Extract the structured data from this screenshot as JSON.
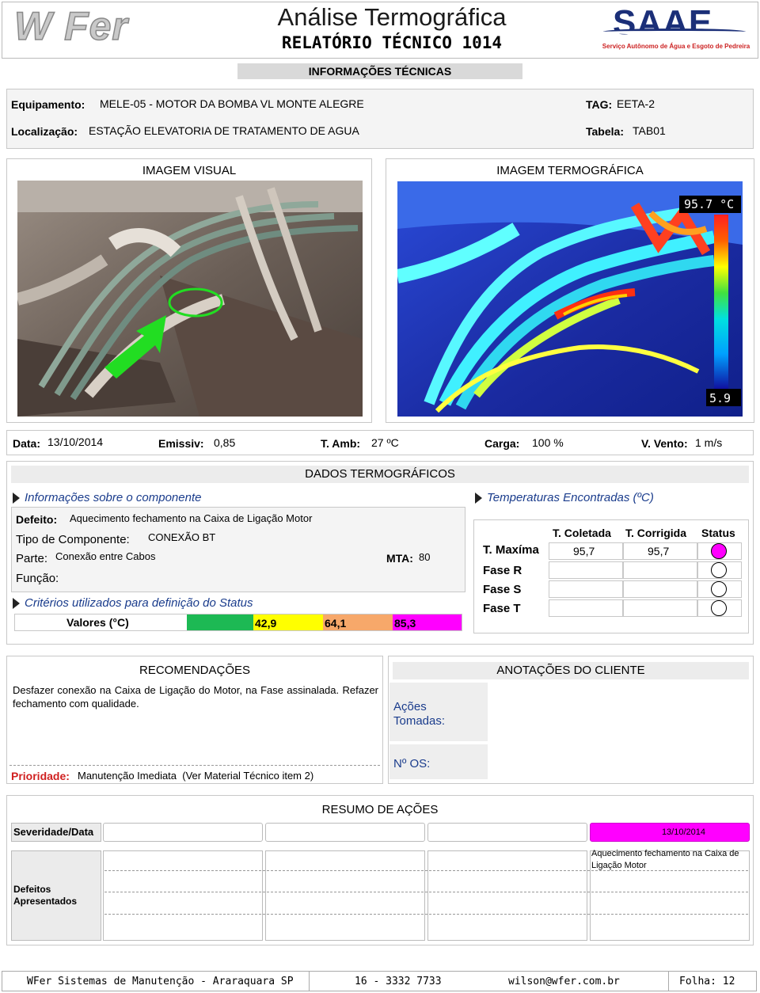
{
  "header": {
    "logo_text": "W Fer",
    "title": "Análise Termográfica",
    "subtitle": "RELATÓRIO TÉCNICO 1014",
    "saae_logo": "SAAE",
    "saae_caption": "Serviço Autônomo de Água e Esgoto de Pedreira"
  },
  "info": {
    "section_title": "INFORMAÇÕES TÉCNICAS",
    "equipamento_label": "Equipamento:",
    "equipamento_value": "MELE-05 - MOTOR DA BOMBA VL MONTE ALEGRE",
    "localizacao_label": "Localização:",
    "localizacao_value": "ESTAÇÃO ELEVATORIA DE TRATAMENTO DE AGUA",
    "tag_label": "TAG:",
    "tag_value": "EETA-2",
    "tabela_label": "Tabela:",
    "tabela_value": "TAB01"
  },
  "images": {
    "visual_title": "IMAGEM VISUAL",
    "thermo_title": "IMAGEM TERMOGRÁFICA",
    "scale_max": "95.7 °C",
    "scale_min": "5.9"
  },
  "conditions": {
    "data_label": "Data:",
    "data_value": "13/10/2014",
    "emissiv_label": "Emissiv:",
    "emissiv_value": "0,85",
    "tamb_label": "T. Amb:",
    "tamb_value": "27 ºC",
    "carga_label": "Carga:",
    "carga_value": "100 %",
    "vento_label": "V. Vento:",
    "vento_value": "1 m/s"
  },
  "dados": {
    "title": "DADOS TERMOGRÁFICOS",
    "component_info_title": "Informações sobre o componente",
    "temps_title": "Temperaturas Encontradas (ºC)",
    "defeito_label": "Defeito:",
    "defeito_value": "Aquecimento fechamento na Caixa de Ligação Motor",
    "tipo_label": "Tipo de Componente:",
    "tipo_value": "CONEXÃO BT",
    "parte_label": "Parte:",
    "parte_value": "Conexão entre Cabos",
    "mta_label": "MTA:",
    "mta_value": "80",
    "funcao_label": "Função:",
    "criterios_title": "Critérios utilizados para definição do Status",
    "valores_label": "Valores (°C)",
    "thresholds": [
      "42,9",
      "64,1",
      "85,3"
    ],
    "threshold_colors": [
      "#1db954",
      "#ffff00",
      "#f7a86a",
      "#ff00ff"
    ],
    "temp_headers": [
      "T. Coletada",
      "T. Corrigida",
      "Status"
    ],
    "temp_rows": [
      {
        "label": "T. Maxíma",
        "coletada": "95,7",
        "corrigida": "95,7",
        "status_color": "#ff00ff"
      },
      {
        "label": "Fase R",
        "coletada": "",
        "corrigida": "",
        "status_color": "#ffffff"
      },
      {
        "label": "Fase S",
        "coletada": "",
        "corrigida": "",
        "status_color": "#ffffff"
      },
      {
        "label": "Fase T",
        "coletada": "",
        "corrigida": "",
        "status_color": "#ffffff"
      }
    ]
  },
  "recomendacoes": {
    "title": "RECOMENDAÇÕES",
    "text": "Desfazer conexão na Caixa de Ligação do Motor, na Fase assinalada. Refazer fechamento com qualidade.",
    "prioridade_label": "Prioridade:",
    "prioridade_value": "Manutenção Imediata  (Ver Material Técnico item 2)"
  },
  "cliente": {
    "title": "ANOTAÇÕES DO CLIENTE",
    "acoes_label": "Ações Tomadas:",
    "os_label": "Nº OS:"
  },
  "resumo": {
    "title": "RESUMO DE AÇÕES",
    "severidade_label": "Severidade/Data",
    "severidade_date": "13/10/2014",
    "severidade_color": "#ff00ff",
    "defeitos_label": "Defeitos Apresentados",
    "defeitos_value": "Aquecimento fechamento na Caixa de Ligação Motor"
  },
  "footer": {
    "company": "WFer Sistemas de Manutenção - Araraquara SP",
    "phone": "16 - 3332 7733",
    "email": "wilson@wfer.com.br",
    "folha": "Folha: 12"
  }
}
